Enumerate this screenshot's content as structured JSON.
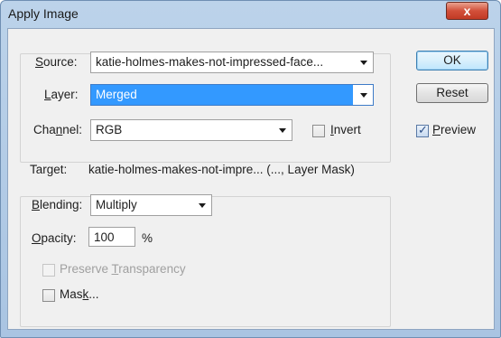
{
  "window": {
    "title": "Apply Image",
    "close_glyph": "x"
  },
  "source": {
    "label": "Source:",
    "label_u": "S",
    "label_rest": "ource:",
    "value": "katie-holmes-makes-not-impressed-face..."
  },
  "layer": {
    "label_u": "L",
    "label_rest": "ayer:",
    "value": "Merged"
  },
  "channel": {
    "label_pre": "Cha",
    "label_u": "n",
    "label_rest": "nel:",
    "value": "RGB"
  },
  "invert": {
    "label_u": "I",
    "label_rest": "nvert",
    "checked": false
  },
  "target": {
    "label": "Target:",
    "value": "katie-holmes-makes-not-impre... (..., Layer Mask)"
  },
  "blending": {
    "label_u": "B",
    "label_rest": "lending:",
    "value": "Multiply"
  },
  "opacity": {
    "label_u": "O",
    "label_rest": "pacity:",
    "value": "100",
    "unit": "%"
  },
  "preserve_transparency": {
    "label_pre": "Preserve ",
    "label_u": "T",
    "label_rest": "ransparency",
    "checked": false,
    "enabled": false
  },
  "mask": {
    "label_pre": "Mas",
    "label_u": "k",
    "label_rest": "...",
    "checked": false
  },
  "buttons": {
    "ok": "OK",
    "reset": "Reset"
  },
  "preview": {
    "label_u": "P",
    "label_rest": "review",
    "checked": true
  }
}
